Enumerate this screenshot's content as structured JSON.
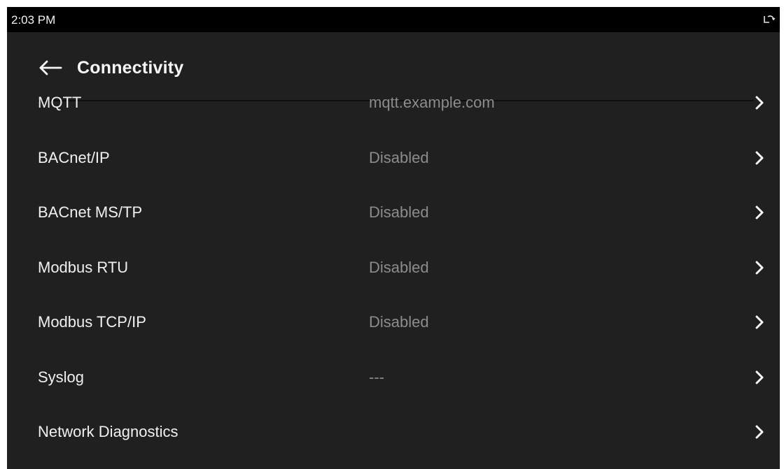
{
  "status_bar": {
    "time": "2:03 PM",
    "rotate_icon": "screen-rotation-icon"
  },
  "header": {
    "back_icon": "arrow-left-icon",
    "title": "Connectivity"
  },
  "colors": {
    "background": "#202020",
    "status_bar": "#000000",
    "primary_text": "#f0f0f0",
    "secondary_text": "#8c8c8c"
  },
  "rows": [
    {
      "label": "MQTT",
      "value": "mqtt.example.com",
      "icon": "chevron-right-icon"
    },
    {
      "label": "BACnet/IP",
      "value": "Disabled",
      "icon": "chevron-right-icon"
    },
    {
      "label": "BACnet MS/TP",
      "value": "Disabled",
      "icon": "chevron-right-icon"
    },
    {
      "label": "Modbus RTU",
      "value": "Disabled",
      "icon": "chevron-right-icon"
    },
    {
      "label": "Modbus TCP/IP",
      "value": "Disabled",
      "icon": "chevron-right-icon"
    },
    {
      "label": "Syslog",
      "value": "---",
      "icon": "chevron-right-icon"
    },
    {
      "label": "Network Diagnostics",
      "value": "",
      "icon": "chevron-right-icon"
    }
  ]
}
